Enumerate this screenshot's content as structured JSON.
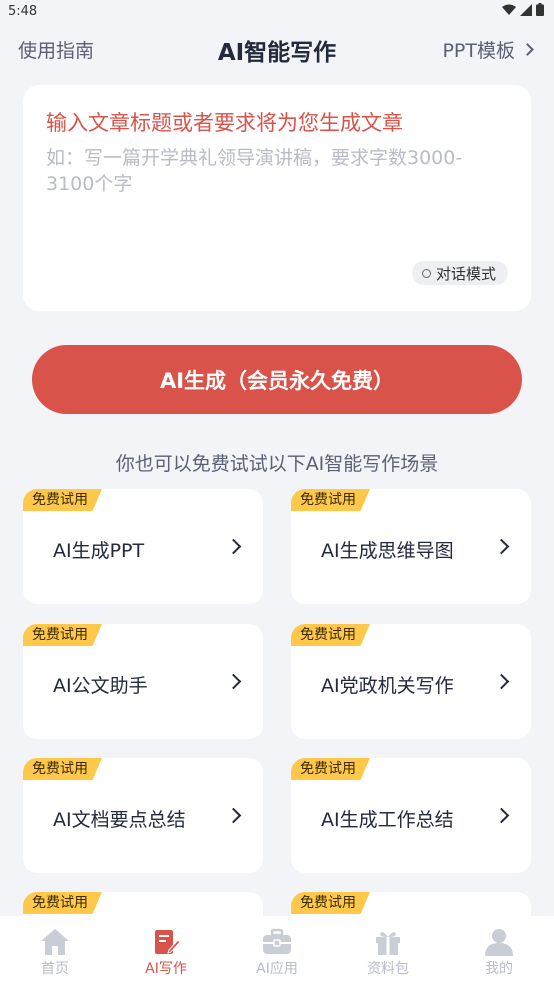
{
  "status_bar": {
    "time": "5:48"
  },
  "nav": {
    "left_label": "使用指南",
    "title": "AI智能写作",
    "right_label": "PPT模板"
  },
  "input": {
    "prompt": "输入文章标题或者要求将为您生成文章",
    "placeholder": "如：写一篇开学典礼领导演讲稿，要求字数3000-3100个字",
    "mode_label": "对话模式"
  },
  "generate_button": "AI生成（会员永久免费）",
  "scenes": {
    "subtitle": "你也可以免费试试以下AI智能写作场景",
    "tag": "免费试用",
    "items": [
      {
        "label": "AI生成PPT"
      },
      {
        "label": "AI生成思维导图"
      },
      {
        "label": "AI公文助手"
      },
      {
        "label": "AI党政机关写作"
      },
      {
        "label": "AI文档要点总结"
      },
      {
        "label": "AI生成工作总结"
      },
      {
        "label": ""
      },
      {
        "label": ""
      }
    ]
  },
  "tabbar": {
    "tabs": [
      {
        "label": "首页",
        "icon": "home-icon"
      },
      {
        "label": "AI写作",
        "icon": "write-icon",
        "active": true
      },
      {
        "label": "AI应用",
        "icon": "toolbox-icon"
      },
      {
        "label": "资料包",
        "icon": "gift-icon"
      },
      {
        "label": "我的",
        "icon": "user-icon"
      }
    ]
  },
  "colors": {
    "accent": "#d9534a",
    "tag": "#ffc84a",
    "background": "#f3f4f8"
  }
}
